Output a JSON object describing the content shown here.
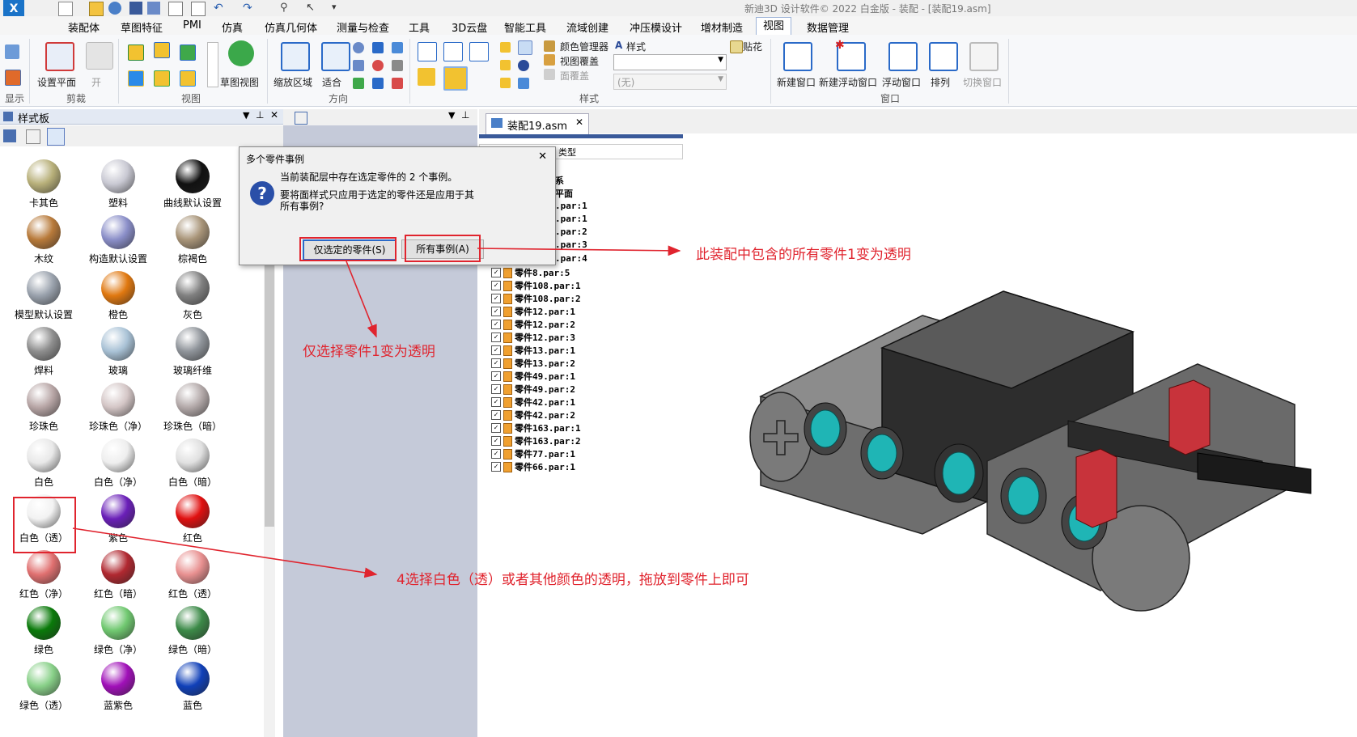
{
  "window": {
    "title": "新迪3D 设计软件© 2022 白金版 - 装配 - [装配19.asm]"
  },
  "menu_tabs": [
    "装配体",
    "草图特征",
    "PMI",
    "仿真",
    "仿真几何体",
    "测量与检查",
    "工具",
    "3D云盘",
    "智能工具",
    "流域创建",
    "冲压模设计",
    "增材制造",
    "视图",
    "数据管理"
  ],
  "active_tab": "视图",
  "ribbon": {
    "display_label": "显示",
    "set_plane": "设置平面",
    "open_label": "开",
    "clip_label": "剪裁",
    "sketch_view": "草图视图",
    "view_group": "视图",
    "zoom_area": "缩放区域",
    "fit": "适合",
    "direction_group": "方向",
    "color_manager": "颜色管理器",
    "view_overlay": "视图覆盖",
    "face_overlay": "面覆盖",
    "style_label": "样式",
    "style_dropdown_value": "",
    "none_value": "(无)",
    "decal": "贴花",
    "style_group": "样式",
    "new_window": "新建窗口",
    "new_float_window": "新建浮动窗口",
    "float_window": "浮动窗口",
    "arrange": "排列",
    "switch_window": "切换窗口",
    "window_group": "窗口"
  },
  "style_panel": {
    "title": "样式板",
    "swatches": [
      {
        "label": "卡其色",
        "color": "#b8b07a"
      },
      {
        "label": "塑料",
        "color": "#c9c9d3"
      },
      {
        "label": "曲线默认设置",
        "color": "#111111"
      },
      {
        "label": "木纹",
        "color": "#b87a3a"
      },
      {
        "label": "构造默认设置",
        "color": "#8a8ec8"
      },
      {
        "label": "棕褐色",
        "color": "#a89478"
      },
      {
        "label": "模型默认设置",
        "color": "#9aa2ad"
      },
      {
        "label": "橙色",
        "color": "#e07810"
      },
      {
        "label": "灰色",
        "color": "#808080"
      },
      {
        "label": "焊料",
        "color": "#8e8e8e"
      },
      {
        "label": "玻璃",
        "color": "#a9c2d6"
      },
      {
        "label": "玻璃纤维",
        "color": "#8f949a"
      },
      {
        "label": "珍珠色",
        "color": "#b8a6a6"
      },
      {
        "label": "珍珠色（净）",
        "color": "#d4c6c6"
      },
      {
        "label": "珍珠色（暗）",
        "color": "#b4aaaa"
      },
      {
        "label": "白色",
        "color": "#e8e8e8"
      },
      {
        "label": "白色（净）",
        "color": "#eeeeee"
      },
      {
        "label": "白色（暗）",
        "color": "#e0e0e0"
      },
      {
        "label": "白色（透）",
        "color": "#f2f2f2"
      },
      {
        "label": "紫色",
        "color": "#6a1fb8"
      },
      {
        "label": "红色",
        "color": "#e01010"
      },
      {
        "label": "红色（净）",
        "color": "#e07070"
      },
      {
        "label": "红色（暗）",
        "color": "#b02830"
      },
      {
        "label": "红色（透）",
        "color": "#e89090"
      },
      {
        "label": "绿色",
        "color": "#0a7a0a"
      },
      {
        "label": "绿色（净）",
        "color": "#70c870"
      },
      {
        "label": "绿色（暗）",
        "color": "#3c8a48"
      },
      {
        "label": "绿色（透）",
        "color": "#88d088"
      },
      {
        "label": "蓝紫色",
        "color": "#a010b8"
      },
      {
        "label": "蓝色",
        "color": "#1040b8"
      }
    ]
  },
  "document_tab": "装配19.asm",
  "tree": {
    "partial_top": "类型",
    "partial_rows": [
      "系",
      "平面",
      ".par:1",
      ".par:1",
      ".par:2",
      ".par:3",
      ".par:4"
    ],
    "rows": [
      "零件8.par:5",
      "零件108.par:1",
      "零件108.par:2",
      "零件12.par:1",
      "零件12.par:2",
      "零件12.par:3",
      "零件13.par:1",
      "零件13.par:2",
      "零件49.par:1",
      "零件49.par:2",
      "零件42.par:1",
      "零件42.par:2",
      "零件163.par:1",
      "零件163.par:2",
      "零件77.par:1",
      "零件66.par:1"
    ]
  },
  "dialog": {
    "title": "多个零件事例",
    "message_line1": "当前装配层中存在选定零件的 2 个事例。",
    "message_line2": "要将面样式只应用于选定的零件还是应用于其",
    "message_line3": "所有事例?",
    "btn_selected": "仅选定的零件(S)",
    "btn_all": "所有事例(A)",
    "close": "✕"
  },
  "annotations": {
    "all_instances": "此装配中包含的所有零件1变为透明",
    "only_selected": "仅选择零件1变为透明",
    "step4": "4选择白色（透）或者其他颜色的透明，拖放到零件上即可"
  },
  "colors": {
    "annotation_red": "#e0242e",
    "teal": "#1fb5b5",
    "part_gray": "#7f7f7f",
    "part_red": "#c8333b"
  }
}
